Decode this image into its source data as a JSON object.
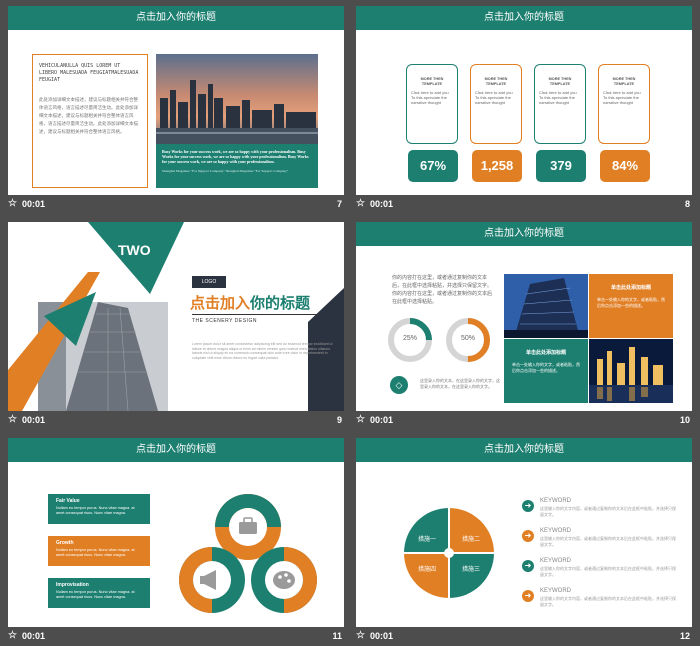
{
  "colors": {
    "green": "#1d7f70",
    "orange": "#e17f25",
    "dark": "#2c3340"
  },
  "slides": [
    {
      "num": "7",
      "duration": "00:01",
      "header": "点击加入你的标题",
      "latin_title": "VEHICULANULLA QUIS LOREM UT LIBERO MALESUADA FEUGIATMALESUADA FEUGIAT",
      "body_text": "此处添加详细文本描述，建议与标题相关并符合整体语言风格，语言描述尽量简洁生动。此处添加详细文本描述，建议与标题相关并符合整体语言风格，语言描述尽量简洁生动。此处添加详细文本描述，建议与标题相关并符合整体语言风格。",
      "caption": "Busy Works for your success work, we are so happy with your professionalism. Busy Works for your success work, we are so happy with your professionalism. Busy Works for your success work, we are so happy with your professionalism.",
      "credit": "Shanghai Magazine \"For Support Company\" Shanghai Magazine \"For Support Company\""
    },
    {
      "num": "8",
      "duration": "00:01",
      "header": "点击加入你的标题",
      "cards": [
        {
          "title": "MORE THEN TEMPLATE",
          "text": "Click here to add you To  this  apreciate the narrative thought",
          "value": "67%",
          "color": "green"
        },
        {
          "title": "MORE THEN TEMPLATE",
          "text": "Click here to add you To  this  apreciate the narrative thought",
          "value": "1,258",
          "color": "orange"
        },
        {
          "title": "MORE THEN TEMPLATE",
          "text": "Click here to add you To  this  apreciate the narrative thought",
          "value": "379",
          "color": "green"
        },
        {
          "title": "MORE THEN TEMPLATE",
          "text": "Click here to add you To  this  apreciate the narrative thought",
          "value": "84%",
          "color": "orange"
        }
      ]
    },
    {
      "num": "9",
      "duration": "00:01",
      "big": "TWO",
      "logo": "LOGO",
      "title_a": "点击加入",
      "title_b": "你的标题",
      "subtitle": "THE SCENERY DESIGN",
      "body": "Lorem ipsum dolor sit amet consectetur adipiscing elit sed do eiusmod tempor incididunt ut labore et dolore magna aliqua ut enim ad minim veniam quis nostrud exercitation ullamco laboris nisi ut aliquip ex ea commodo consequat duis aute irure dolor in reprehenderit in voluptate velit esse cillum dolore eu fugiat nulla pariatur."
    },
    {
      "num": "10",
      "duration": "00:01",
      "header": "点击加入你的标题",
      "intro": "你的内容打在这里，或者通过复制你的文本后，在此框中选择粘贴，并选择只保留文字。你的内容打在这里，或者通过复制你的文本后在此框中选择粘贴。",
      "donuts": [
        {
          "label": "25%",
          "value": 0.25
        },
        {
          "label": "50%",
          "value": 0.5
        }
      ],
      "note": "这里录入你的文本，在这里录入你的文字，这里录入你的文本，在这里录入你的文字。",
      "box1_title": "单击此处添加标题",
      "box1_text": "单击一处输入你的文字，或者粘贴，然后你点击添加一些的描述。",
      "box2_title": "单击此处添加标题",
      "box2_text": "单击一处输入你的文字，或者粘贴，然后你点击添加一些的描述。"
    },
    {
      "num": "11",
      "duration": "00:01",
      "header": "点击加入你的标题",
      "items": [
        {
          "title": "Fair Value",
          "text": "Nullam eu tempor purus. Nunc vitae magna. at amet consequat risus. Nunc vitae magna.",
          "color": "green"
        },
        {
          "title": "Growth",
          "text": "Nullam eu tempor purus. Nunc vitae magna. at amet consequat risus. Nunc vitae magna.",
          "color": "orange"
        },
        {
          "title": "Improvisation",
          "text": "Nullam eu tempor purus. Nunc vitae magna. at amet consequat risus. Nunc vitae magna.",
          "color": "green"
        }
      ]
    },
    {
      "num": "12",
      "duration": "00:01",
      "header": "点击加入你的标题",
      "quads": [
        "措施一",
        "措施二",
        "措施四",
        "措施三"
      ],
      "keywords": [
        {
          "title": "KEYWORD",
          "text": "这里输入你的文字内容，或者通过复制你的文本后在此框中粘贴，并选择只保留文字。",
          "color": "green"
        },
        {
          "title": "KEYWORD",
          "text": "这里输入你的文字内容，或者通过复制你的文本后在此框中粘贴，并选择只保留文字。",
          "color": "orange"
        },
        {
          "title": "KEYWORD",
          "text": "这里输入你的文字内容，或者通过复制你的文本后在此框中粘贴，并选择只保留文字。",
          "color": "green"
        },
        {
          "title": "KEYWORD",
          "text": "这里输入你的文字内容，或者通过复制你的文本后在此框中粘贴，并选择只保留文字。",
          "color": "orange"
        }
      ]
    }
  ]
}
